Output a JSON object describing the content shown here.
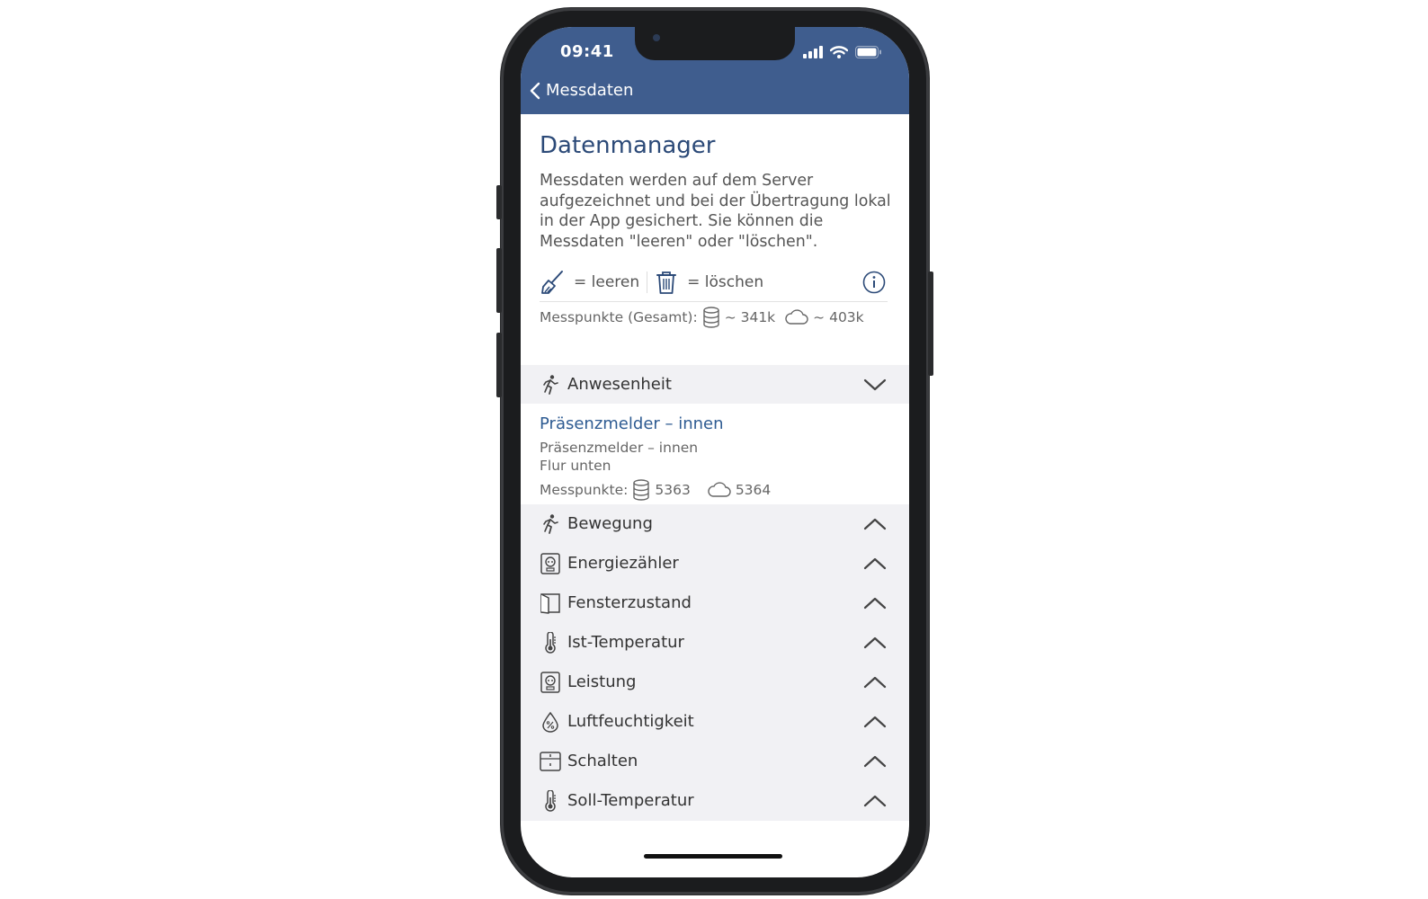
{
  "status_bar": {
    "time": "09:41"
  },
  "nav": {
    "back_label": "Messdaten"
  },
  "page": {
    "title": "Datenmanager",
    "description": "Messdaten werden auf dem Server aufgezeichnet und bei der Übertragung lokal in der App gesichert. Sie können die Messdaten \"leeren\" oder \"löschen\".",
    "legend": {
      "clear_label": "= leeren",
      "delete_label": "= löschen"
    },
    "total": {
      "label": "Messpunkte (Gesamt):",
      "local": "~ 341k",
      "cloud": "~ 403k"
    }
  },
  "groups": [
    {
      "label": "Anwesenheit",
      "icon": "person-walk-icon",
      "expanded": true
    },
    {
      "label": "Bewegung",
      "icon": "person-walk-icon",
      "expanded": false
    },
    {
      "label": "Energiezähler",
      "icon": "meter-icon",
      "expanded": false
    },
    {
      "label": "Fensterzustand",
      "icon": "window-icon",
      "expanded": false
    },
    {
      "label": "Ist-Temperatur",
      "icon": "thermometer-icon",
      "expanded": false
    },
    {
      "label": "Leistung",
      "icon": "meter-icon",
      "expanded": false
    },
    {
      "label": "Luftfeuchtigkeit",
      "icon": "humidity-drop-icon",
      "expanded": false
    },
    {
      "label": "Schalten",
      "icon": "switch-icon",
      "expanded": false
    },
    {
      "label": "Soll-Temperatur",
      "icon": "thermometer-icon",
      "expanded": false
    }
  ],
  "device": {
    "name": "Präsenzmelder – innen",
    "subtitle": "Präsenzmelder – innen",
    "location": "Flur unten",
    "points_label": "Messpunkte:",
    "local": "5363",
    "cloud": "5364"
  },
  "colors": {
    "header": "#3f5d8e",
    "accent": "#2e5b92",
    "group_bg": "#f1f1f4"
  }
}
